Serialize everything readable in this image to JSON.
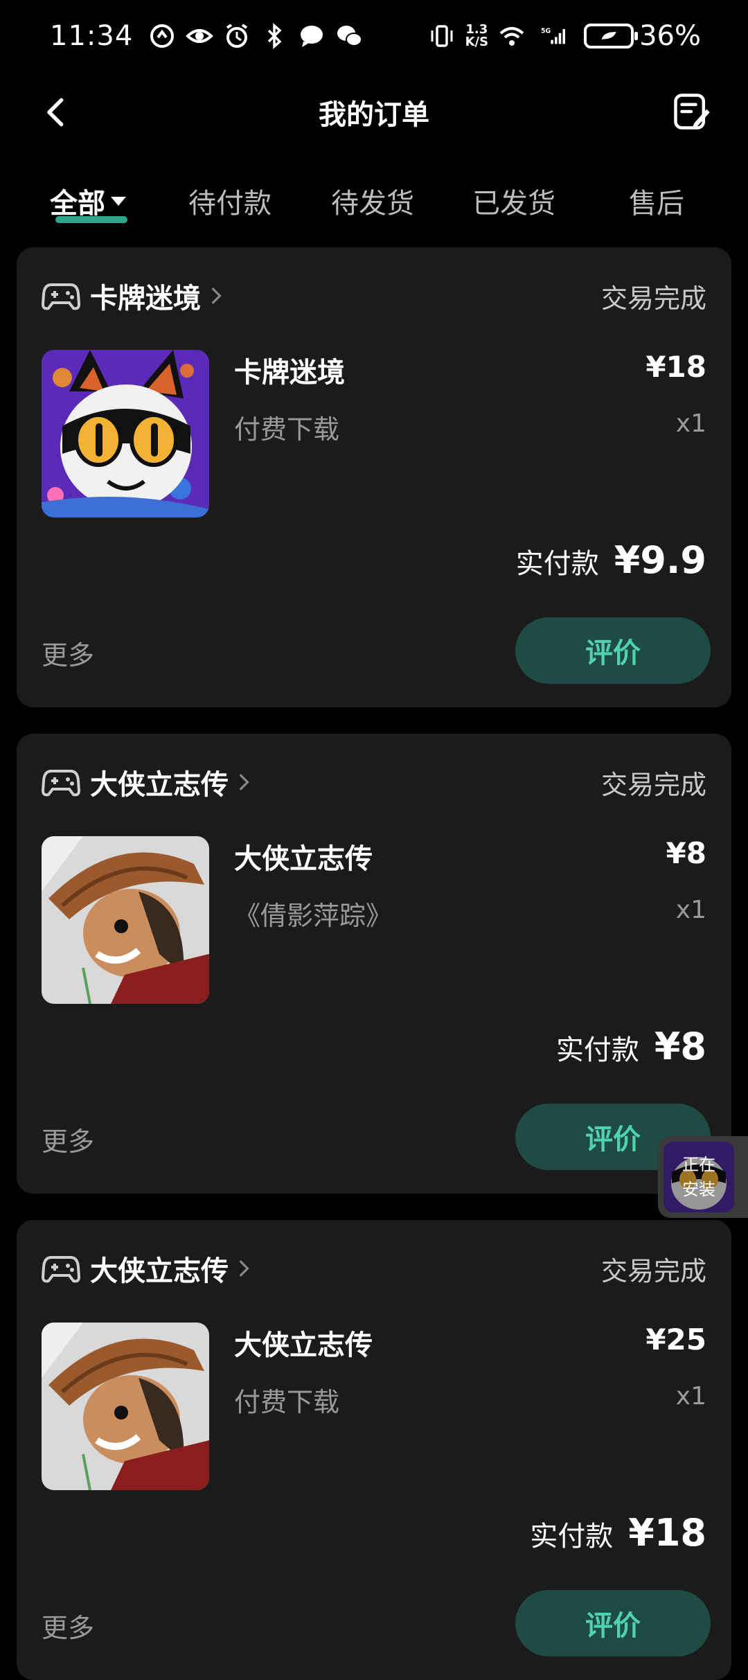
{
  "status_bar": {
    "time": "11:34",
    "net_speed_top": "1.3",
    "net_speed_bottom": "K/S",
    "signal_label": "5G",
    "battery": "36%"
  },
  "header": {
    "title": "我的订单"
  },
  "tabs": [
    {
      "label": "全部"
    },
    {
      "label": "待付款"
    },
    {
      "label": "待发货"
    },
    {
      "label": "已发货"
    },
    {
      "label": "售后"
    }
  ],
  "orders": [
    {
      "store": "卡牌迷境",
      "status": "交易完成",
      "product": "卡牌迷境",
      "subtitle": "付费下载",
      "price": "¥18",
      "qty": "x1",
      "paid_label": "实付款",
      "paid_amount": "¥9.9",
      "more": "更多",
      "review": "评价"
    },
    {
      "store": "大侠立志传",
      "status": "交易完成",
      "product": "大侠立志传",
      "subtitle": "《倩影萍踪》",
      "price": "¥8",
      "qty": "x1",
      "paid_label": "实付款",
      "paid_amount": "¥8",
      "more": "更多",
      "review": "评价"
    },
    {
      "store": "大侠立志传",
      "status": "交易完成",
      "product": "大侠立志传",
      "subtitle": "付费下载",
      "price": "¥25",
      "qty": "x1",
      "paid_label": "实付款",
      "paid_amount": "¥18",
      "more": "更多",
      "review": "评价"
    }
  ],
  "install_float": {
    "line1": "正在",
    "line2": "安装"
  },
  "colors": {
    "accent": "#2fa38b",
    "button_bg": "#1f4b45",
    "button_text": "#4fd2ad",
    "card_bg": "#1b1b1b"
  }
}
